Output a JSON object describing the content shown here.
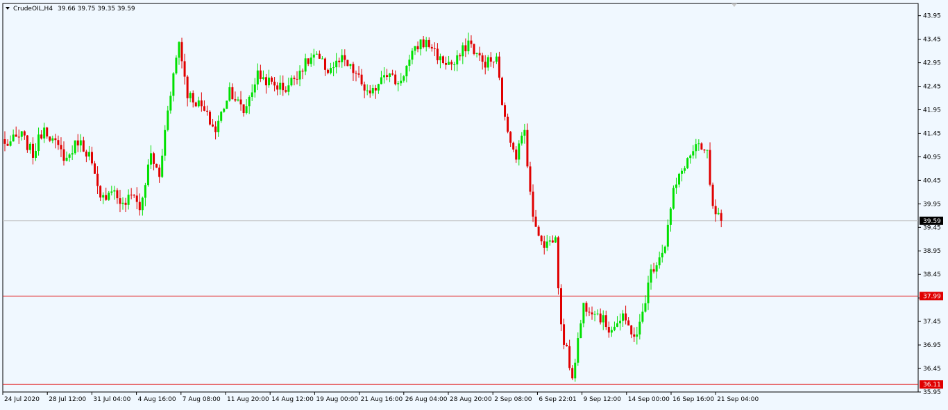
{
  "window": {
    "symbol_label": "CrudeOIL,H4",
    "ohlc_readout": "39.66 39.75 39.35 39.59"
  },
  "colors": {
    "background": "#f0f8ff",
    "bull": "#00e000",
    "bear": "#e00000",
    "grid_line": "#000000",
    "price_line": "#c0c0c0",
    "level_line": "#e00000"
  },
  "chart_data": {
    "type": "candlestick",
    "title": "CrudeOIL,H4",
    "ylim": [
      35.95,
      44.21
    ],
    "y_ticks": [
      "43.95",
      "43.45",
      "42.95",
      "42.45",
      "41.95",
      "41.45",
      "40.95",
      "40.45",
      "39.95",
      "39.45",
      "38.95",
      "38.45",
      "37.95",
      "37.45",
      "36.95",
      "36.45",
      "35.95"
    ],
    "x_ticks": [
      "24 Jul 2020",
      "28 Jul 12:00",
      "31 Jul 04:00",
      "4 Aug 16:00",
      "7 Aug 08:00",
      "11 Aug 20:00",
      "14 Aug 12:00",
      "19 Aug 00:00",
      "21 Aug 16:00",
      "26 Aug 04:00",
      "28 Aug 20:00",
      "2 Sep 08:00",
      "6 Sep 22:01",
      "9 Sep 12:00",
      "14 Sep 00:00",
      "16 Sep 16:00",
      "21 Sep 04:00"
    ],
    "current_price": 39.59,
    "horizontal_levels": [
      {
        "price": 37.99,
        "label": "37.99"
      },
      {
        "price": 36.11,
        "label": "36.11"
      }
    ],
    "anchors": [
      [
        0,
        41.2
      ],
      [
        6,
        41.4
      ],
      [
        10,
        41.0
      ],
      [
        14,
        41.6
      ],
      [
        18,
        41.2
      ],
      [
        22,
        40.9
      ],
      [
        26,
        41.3
      ],
      [
        30,
        41.0
      ],
      [
        34,
        40.0
      ],
      [
        38,
        40.3
      ],
      [
        42,
        39.9
      ],
      [
        46,
        40.2
      ],
      [
        48,
        39.8
      ],
      [
        52,
        41.0
      ],
      [
        55,
        40.5
      ],
      [
        58,
        42.0
      ],
      [
        62,
        43.4
      ],
      [
        65,
        42.3
      ],
      [
        70,
        42.0
      ],
      [
        75,
        41.5
      ],
      [
        80,
        42.4
      ],
      [
        85,
        41.9
      ],
      [
        90,
        42.7
      ],
      [
        95,
        42.5
      ],
      [
        100,
        42.4
      ],
      [
        105,
        42.8
      ],
      [
        110,
        43.1
      ],
      [
        115,
        42.8
      ],
      [
        120,
        43.0
      ],
      [
        125,
        42.7
      ],
      [
        130,
        42.2
      ],
      [
        135,
        42.8
      ],
      [
        140,
        42.5
      ],
      [
        145,
        43.1
      ],
      [
        148,
        43.4
      ],
      [
        152,
        43.3
      ],
      [
        155,
        43.0
      ],
      [
        160,
        42.9
      ],
      [
        165,
        43.4
      ],
      [
        170,
        42.95
      ],
      [
        175,
        43.0
      ],
      [
        178,
        41.7
      ],
      [
        182,
        41.0
      ],
      [
        185,
        41.5
      ],
      [
        188,
        39.6
      ],
      [
        192,
        39.1
      ],
      [
        196,
        39.2
      ],
      [
        198,
        37.3
      ],
      [
        202,
        36.3
      ],
      [
        206,
        37.8
      ],
      [
        210,
        37.7
      ],
      [
        215,
        37.3
      ],
      [
        220,
        37.5
      ],
      [
        225,
        37.1
      ],
      [
        230,
        38.5
      ],
      [
        235,
        39.1
      ],
      [
        238,
        40.2
      ],
      [
        242,
        40.8
      ],
      [
        246,
        41.15
      ],
      [
        250,
        41.0
      ],
      [
        252,
        39.8
      ],
      [
        255,
        39.59
      ]
    ],
    "pixel_pace": 4.048
  }
}
